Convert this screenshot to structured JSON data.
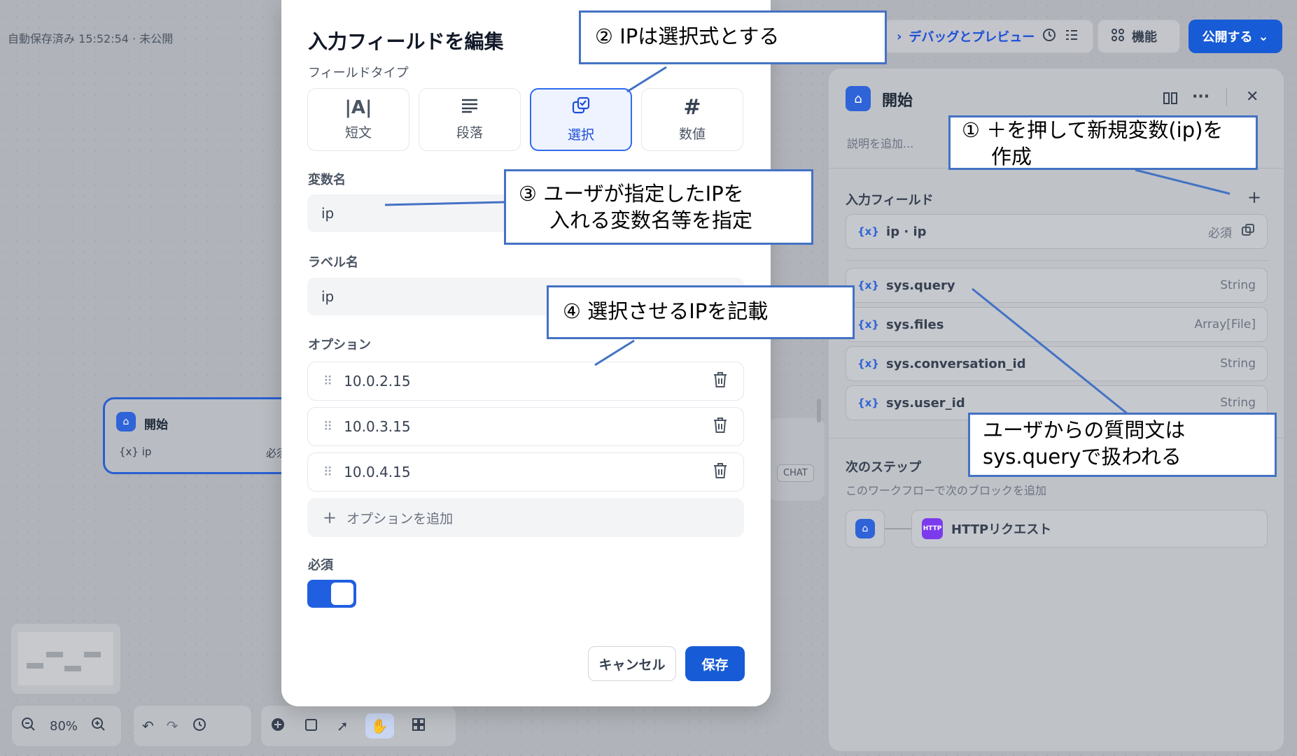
{
  "topbar": {
    "autosave": "自動保存済み 15:52:54 · 未公開",
    "debug_label": "デバッグとプレビュー",
    "features_label": "機能",
    "publish_label": "公開する"
  },
  "canvas": {
    "node_title": "開始",
    "node_var": "{x} ip",
    "node_required": "必須",
    "chat_badge": "CHAT"
  },
  "toolbar": {
    "zoom": "80%"
  },
  "panel": {
    "title": "開始",
    "description_placeholder": "説明を追加...",
    "input_fields_title": "入力フィールド",
    "input_vars": [
      {
        "name": "ip · ip",
        "type": "必須"
      }
    ],
    "sys_vars": [
      {
        "name": "sys.query",
        "type": "String"
      },
      {
        "name": "sys.files",
        "type": "Array[File]"
      },
      {
        "name": "sys.conversation_id",
        "type": "String"
      },
      {
        "name": "sys.user_id",
        "type": "String"
      }
    ],
    "next_step_title": "次のステップ",
    "next_step_desc": "このワークフローで次のブロックを追加",
    "next_block_label": "HTTPリクエスト",
    "http_badge": "HTTP"
  },
  "modal": {
    "title": "入力フィールドを編集",
    "field_type_label": "フィールドタイプ",
    "field_types": [
      {
        "label": "短文",
        "selected": false
      },
      {
        "label": "段落",
        "selected": false
      },
      {
        "label": "選択",
        "selected": true
      },
      {
        "label": "数値",
        "selected": false
      }
    ],
    "var_name_label": "変数名",
    "var_name_value": "ip",
    "label_name_label": "ラベル名",
    "label_name_value": "ip",
    "options_label": "オプション",
    "options": [
      "10.0.2.15",
      "10.0.3.15",
      "10.0.4.15"
    ],
    "add_option_label": "オプションを追加",
    "required_label": "必須",
    "required_on": true,
    "cancel_label": "キャンセル",
    "save_label": "保存"
  },
  "annotations": {
    "c1_line1": "① ＋を押して新規変数(ip)を",
    "c1_line2": "作成",
    "c2": "② IPは選択式とする",
    "c3_line1": "③ ユーザが指定したIPを",
    "c3_line2": "入れる変数名等を指定",
    "c4": "④ 選択させるIPを記載",
    "c5_line1": "ユーザからの質問文は",
    "c5_line2": "sys.queryで扱われる"
  },
  "colors": {
    "accent": "#175bd6",
    "callout_border": "#4472c4",
    "selected_bg": "#eef3ff"
  }
}
